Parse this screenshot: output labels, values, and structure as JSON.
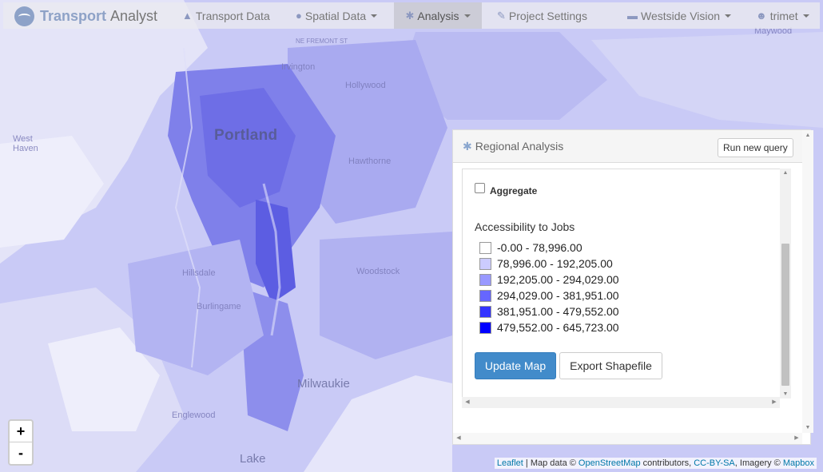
{
  "navbar": {
    "brand_part1": "Transport",
    "brand_part2": "Analyst",
    "items": [
      {
        "label": "Transport Data",
        "icon": "road-icon"
      },
      {
        "label": "Spatial Data",
        "icon": "globe-icon"
      },
      {
        "label": "Analysis",
        "icon": "cog-icon"
      },
      {
        "label": "Project Settings",
        "icon": "wrench-icon"
      }
    ],
    "project": "Westside Vision",
    "user": "trimet"
  },
  "map": {
    "places": {
      "portland": "Portland",
      "milwaukie": "Milwaukie",
      "irvington": "Irvington",
      "hollywood": "Hollywood",
      "hawthorne": "Hawthorne",
      "woodstock": "Woodstock",
      "west_haven": "West Haven",
      "burlingame": "Burlingame",
      "hillsdale": "Hillsdale",
      "lake": "Lake",
      "englewood": "Englewood",
      "fremont": "NE FREMONT ST",
      "maywood": "Maywood"
    }
  },
  "panel": {
    "title": "Regional Analysis",
    "run_button": "Run new query",
    "aggregate_label": "Aggregate",
    "legend_title": "Accessibility to Jobs",
    "legend": [
      {
        "label": "-0.00 - 78,996.00",
        "color": "#ffffff"
      },
      {
        "label": "78,996.00 - 192,205.00",
        "color": "#ccccff"
      },
      {
        "label": "192,205.00 - 294,029.00",
        "color": "#9999ff"
      },
      {
        "label": "294,029.00 - 381,951.00",
        "color": "#6666ff"
      },
      {
        "label": "381,951.00 - 479,552.00",
        "color": "#3333ff"
      },
      {
        "label": "479,552.00 - 645,723.00",
        "color": "#0000ff"
      }
    ],
    "update_button": "Update Map",
    "export_button": "Export Shapefile"
  },
  "zoom": {
    "in": "+",
    "out": "-"
  },
  "attribution": {
    "leaflet": "Leaflet",
    "text1": " | Map data © ",
    "osm": "OpenStreetMap",
    "text2": " contributors, ",
    "license": "CC-BY-SA",
    "text3": ", Imagery © ",
    "mapbox": "Mapbox"
  }
}
